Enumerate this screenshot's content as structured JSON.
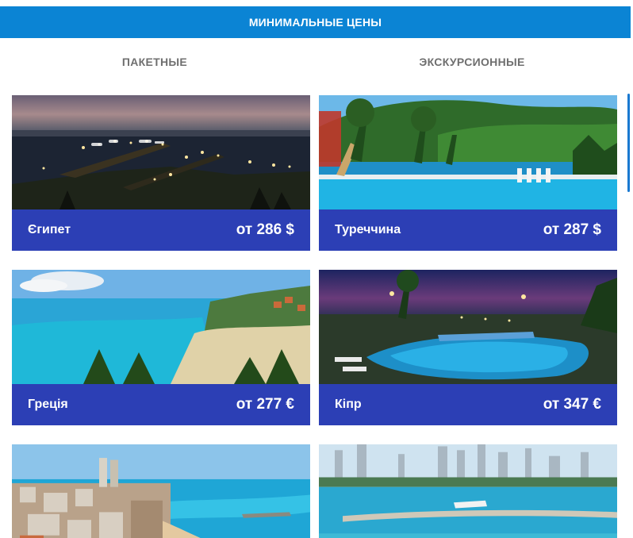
{
  "header": {
    "title": "МИНИМАЛЬНЫЕ ЦЕНЫ"
  },
  "tabs": [
    {
      "label": "ПАКЕТНЫЕ"
    },
    {
      "label": "ЭКСКУРСИОННЫЕ"
    }
  ],
  "cards": [
    {
      "country": "Єгипет",
      "price": "от 286 $"
    },
    {
      "country": "Туреччина",
      "price": "от 287 $"
    },
    {
      "country": "Греція",
      "price": "от 277 €"
    },
    {
      "country": "Кіпр",
      "price": "от 347 €"
    },
    {
      "country": "",
      "price": ""
    },
    {
      "country": "",
      "price": ""
    }
  ],
  "colors": {
    "header_bg": "#0b84d4",
    "caption_bg": "#2c3fb5",
    "tab_text": "#6f6f6f",
    "scrollbar": "#1a79d1"
  }
}
